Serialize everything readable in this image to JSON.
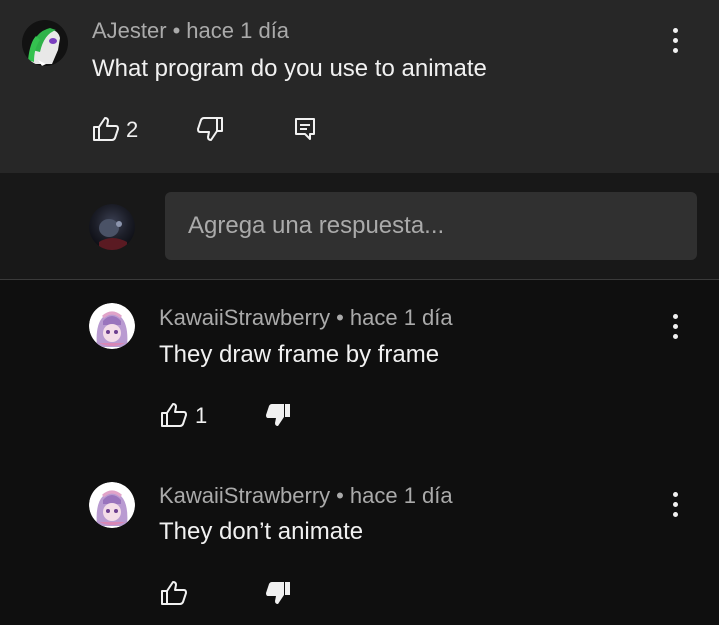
{
  "top_comment": {
    "author": "AJester",
    "time": "hace 1 día",
    "text": "What program do you use to animate",
    "like_count": "2"
  },
  "reply_box": {
    "placeholder": "Agrega una respuesta..."
  },
  "replies": [
    {
      "author": "KawaiiStrawberry",
      "time": "hace 1 día",
      "text": "They draw frame by frame",
      "like_count": "1"
    },
    {
      "author": "KawaiiStrawberry",
      "time": "hace 1 día",
      "text": "They don’t animate",
      "like_count": ""
    }
  ],
  "separator": "•",
  "icons": {
    "like": "thumbs-up-icon",
    "dislike": "thumbs-down-icon",
    "reply": "comment-icon",
    "more": "more-vertical-icon"
  },
  "colors": {
    "top_comment_bg": "#272727",
    "reply_area_bg": "#181818",
    "page_bg": "#0f0f0f",
    "input_bg": "#303030",
    "primary_text": "#f1f1f1",
    "secondary_text": "#aaaaaa"
  }
}
